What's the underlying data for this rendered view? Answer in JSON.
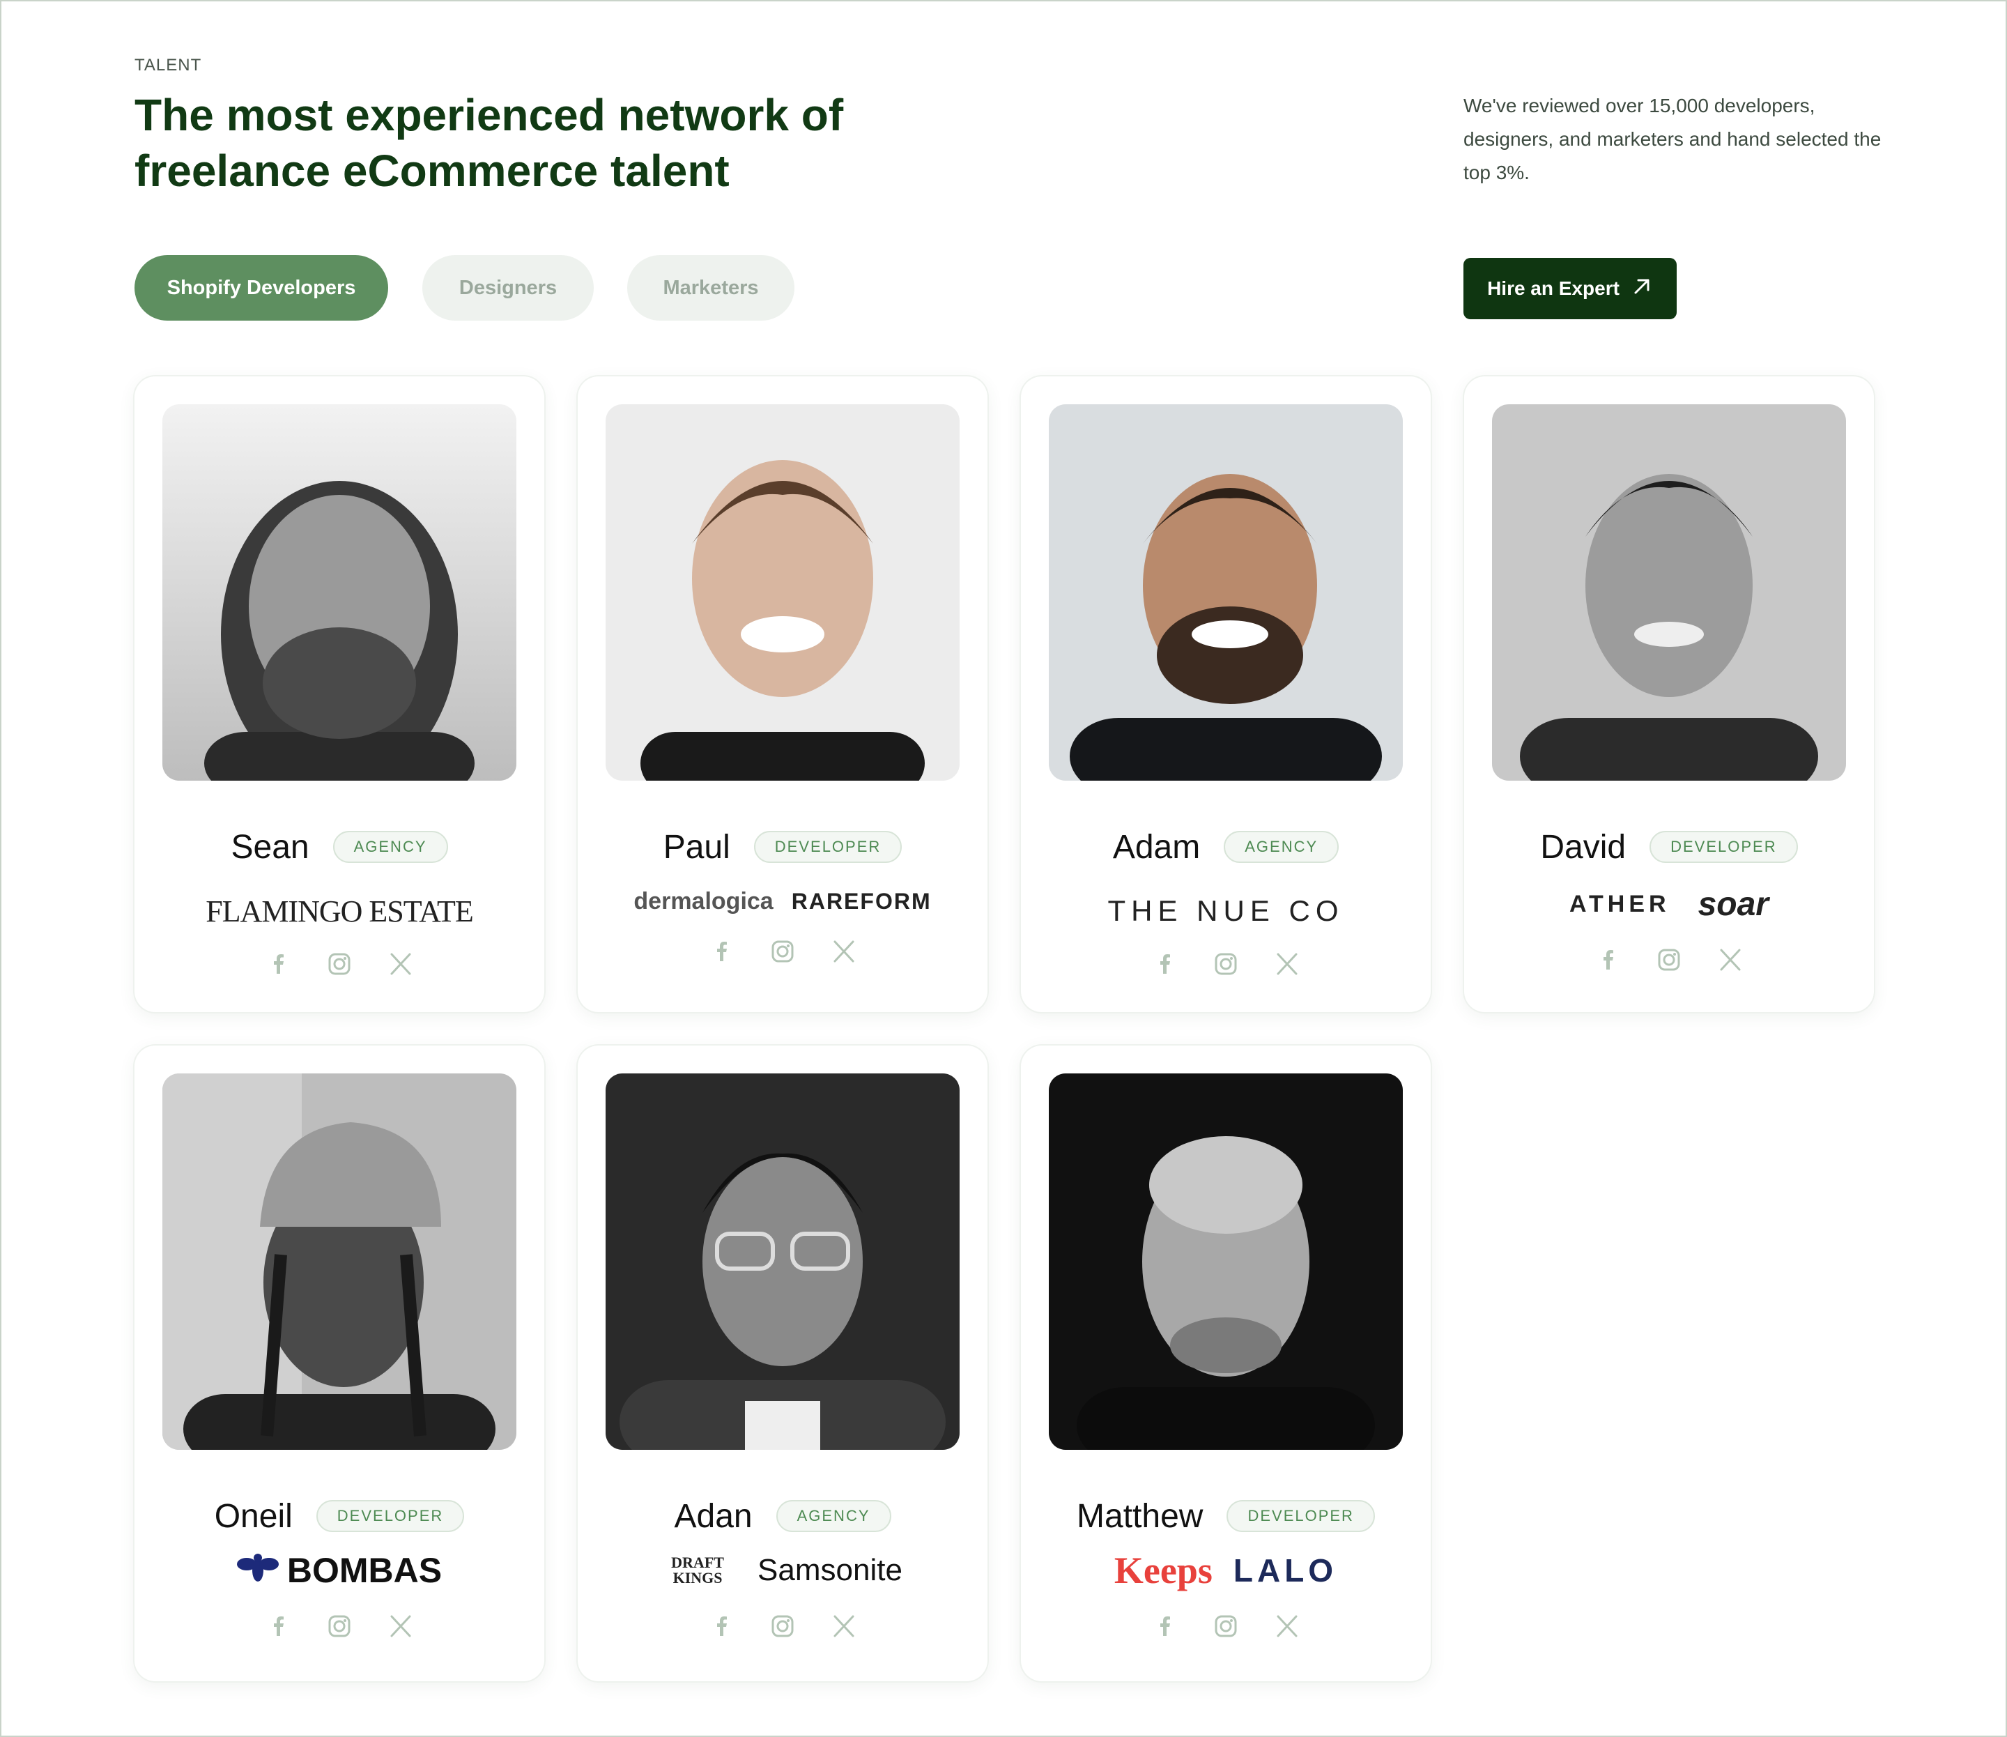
{
  "section": {
    "eyebrow": "TALENT",
    "headline": "The most experienced network of freelance eCommerce talent",
    "intro": "We've reviewed over 15,000 developers, designers, and marketers and hand selected the top 3%."
  },
  "tabs": [
    {
      "label": "Shopify Developers",
      "active": true
    },
    {
      "label": "Designers",
      "active": false
    },
    {
      "label": "Marketers",
      "active": false
    }
  ],
  "cta": {
    "label": "Hire an Expert",
    "icon": "arrow-up-right-icon"
  },
  "colors": {
    "brand_dark": "#0f3611",
    "brand_green": "#5e8f60",
    "headline": "#113a14"
  },
  "talent": [
    {
      "name": "Sean",
      "badge": "AGENCY",
      "brands": [
        "FLAMINGO ESTATE"
      ]
    },
    {
      "name": "Paul",
      "badge": "DEVELOPER",
      "brands": [
        "dermalogica",
        "RAREFORM"
      ]
    },
    {
      "name": "Adam",
      "badge": "AGENCY",
      "brands": [
        "THE NUE CO"
      ]
    },
    {
      "name": "David",
      "badge": "DEVELOPER",
      "brands": [
        "ATHER",
        "soar"
      ]
    },
    {
      "name": "Oneil",
      "badge": "DEVELOPER",
      "brands": [
        "BOMBAS"
      ]
    },
    {
      "name": "Adan",
      "badge": "AGENCY",
      "brands": [
        "DRAFT KINGS",
        "Samsonite"
      ]
    },
    {
      "name": "Matthew",
      "badge": "DEVELOPER",
      "brands": [
        "Keeps",
        "LALO"
      ]
    }
  ],
  "social_icons": [
    "facebook-icon",
    "instagram-icon",
    "x-icon"
  ]
}
